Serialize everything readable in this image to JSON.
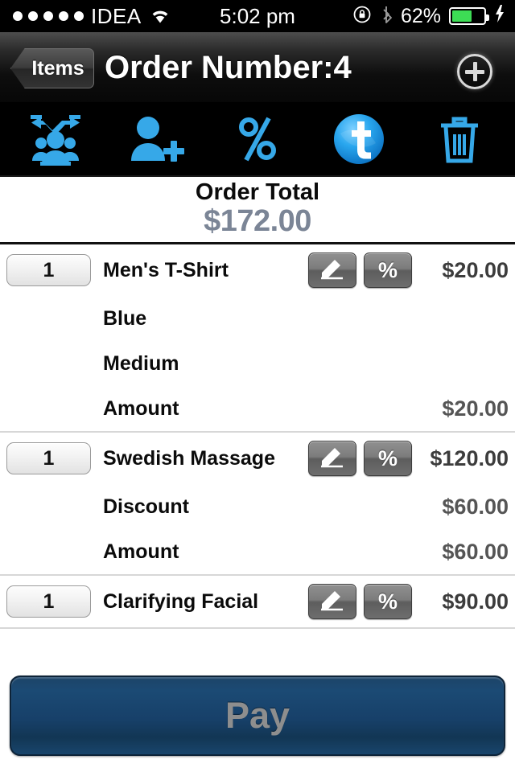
{
  "status_bar": {
    "signal_dots": 5,
    "carrier": "IDEA",
    "wifi_icon": "wifi-icon",
    "time": "5:02 pm",
    "rotation_lock_icon": "rotation-lock-icon",
    "bluetooth_icon": "bluetooth-icon",
    "battery_percent": "62%",
    "battery_level": 62,
    "battery_color": "#3ddc55",
    "charging_icon": "lightning-bolt-icon"
  },
  "nav_bar": {
    "back_label": "Items",
    "title": "Order Number:4",
    "add_icon": "plus-circle-icon"
  },
  "toolbar": {
    "items": [
      {
        "name": "split-check-icon",
        "label": "Split Check"
      },
      {
        "name": "add-customer-icon",
        "label": "Add Customer"
      },
      {
        "name": "percent-discount-icon",
        "label": "Discount"
      },
      {
        "name": "tab-badge-icon",
        "label": "t"
      },
      {
        "name": "trash-icon",
        "label": "Delete"
      }
    ],
    "accent_color": "#36a8e8"
  },
  "order_total": {
    "label": "Order Total",
    "value": "$172.00",
    "value_color": "#7b8596"
  },
  "items": [
    {
      "qty": "1",
      "name": "Men's T-Shirt",
      "price": "$20.00",
      "edit_icon": "pencil-edit-icon",
      "percent_label": "%",
      "sub_rows": [
        {
          "label": "Blue",
          "value": ""
        },
        {
          "label": "Medium",
          "value": ""
        },
        {
          "label": "Amount",
          "value": "$20.00"
        }
      ]
    },
    {
      "qty": "1",
      "name": "Swedish Massage",
      "price": "$120.00",
      "edit_icon": "pencil-edit-icon",
      "percent_label": "%",
      "sub_rows": [
        {
          "label": "Discount",
          "value": "$60.00"
        },
        {
          "label": "Amount",
          "value": "$60.00"
        }
      ]
    },
    {
      "qty": "1",
      "name": "Clarifying Facial",
      "price": "$90.00",
      "edit_icon": "pencil-edit-icon",
      "percent_label": "%",
      "sub_rows": []
    }
  ],
  "pay_button": {
    "label": "Pay",
    "color": "#17406a"
  }
}
